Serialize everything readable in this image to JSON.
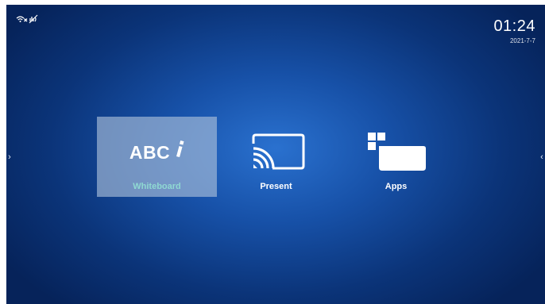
{
  "status": {
    "icons": [
      "wifi-off-icon",
      "network-off-icon"
    ]
  },
  "clock": {
    "time": "01:24",
    "date": "2021-7-7"
  },
  "nav": {
    "left_glyph": "›",
    "right_glyph": "‹"
  },
  "tiles": [
    {
      "label": "Whiteboard",
      "icon": "abc-whiteboard-icon",
      "selected": true
    },
    {
      "label": "Present",
      "icon": "screen-cast-icon",
      "selected": false
    },
    {
      "label": "Apps",
      "icon": "apps-icon",
      "selected": false
    }
  ],
  "whiteboard_logo_text": "ABC",
  "colors": {
    "background": "#0b3479",
    "background_center": "#2a71cf",
    "selected_tile": "#b0c4dc",
    "selected_label": "#8fd9d2",
    "icon": "#ffffff"
  }
}
